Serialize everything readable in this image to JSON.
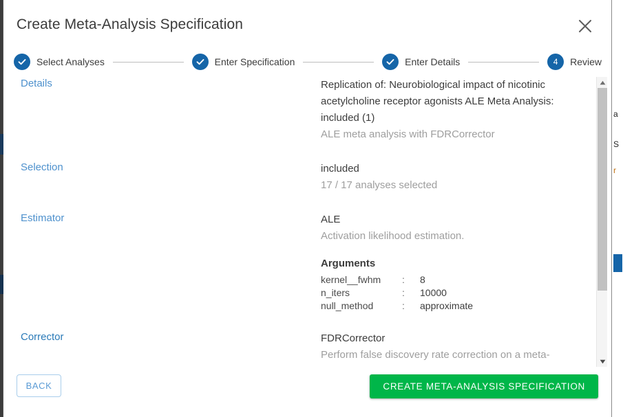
{
  "modal": {
    "title": "Create Meta-Analysis Specification",
    "close_icon": "close-icon"
  },
  "stepper": {
    "steps": [
      {
        "label": "Select Analyses",
        "state": "complete",
        "marker": "check-icon"
      },
      {
        "label": "Enter Specification",
        "state": "complete",
        "marker": "check-icon"
      },
      {
        "label": "Enter Details",
        "state": "complete",
        "marker": "check-icon"
      },
      {
        "label": "Review",
        "state": "active",
        "marker": "4"
      }
    ],
    "active_color": "#1565a8",
    "connector_color": "#bdbdbd"
  },
  "review": {
    "details": {
      "label": "Details",
      "primary": "Replication of: Neurobiological impact of nicotinic acetylcholine receptor agonists ALE Meta Analysis: included (1)",
      "secondary": "ALE meta analysis with FDRCorrector"
    },
    "selection": {
      "label": "Selection",
      "primary": "included",
      "secondary": "17 / 17 analyses selected"
    },
    "estimator": {
      "label": "Estimator",
      "primary": "ALE",
      "secondary": "Activation likelihood estimation.",
      "arguments_title": "Arguments",
      "arguments": [
        {
          "key": "kernel__fwhm",
          "sep": ":",
          "value": "8"
        },
        {
          "key": "n_iters",
          "sep": ":",
          "value": "10000"
        },
        {
          "key": "null_method",
          "sep": ":",
          "value": "approximate"
        }
      ]
    },
    "corrector": {
      "label": "Corrector",
      "primary": "FDRCorrector",
      "secondary": "Perform false discovery rate correction on a meta-analysis."
    }
  },
  "scrollbar": {
    "up_icon": "caret-up-icon",
    "down_icon": "caret-down-icon"
  },
  "footer": {
    "back_label": "BACK",
    "create_label": "CREATE META-ANALYSIS SPECIFICATION",
    "create_color": "#00b649",
    "back_color": "#5b9bd5"
  },
  "background": {
    "right_fragments": [
      "a",
      "S",
      "r"
    ],
    "right_highlight_color": "#1565a8"
  }
}
